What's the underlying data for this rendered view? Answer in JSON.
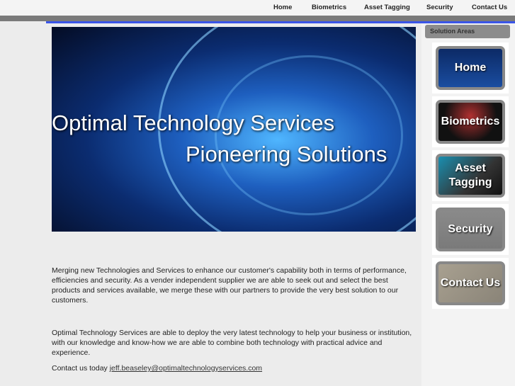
{
  "nav": [
    "Home",
    "Biometrics",
    "Asset Tagging",
    "Security",
    "Contact Us"
  ],
  "hero": {
    "title": "Optimal Technology Services",
    "subtitle": "Pioneering Solutions"
  },
  "sidebar": {
    "heading": "Solution Areas",
    "buttons": [
      "Home",
      "Biometrics",
      "Asset Tagging",
      "Security",
      "Contact Us"
    ]
  },
  "content": {
    "p1": "Merging new Technologies and Services to enhance our customer's capability both in terms of performance, efficiencies and security. As a vender independent supplier we are able to seek out and select the best products and services available, we merge these with our partners to provide the very best solution to our customers.",
    "p2": "Optimal Technology Services are able to deploy the very latest technology to help your business or institution, with our knowledge and know-how we are able to combine both technology with practical advice and experience.",
    "contact_prefix": "Contact us today",
    "email": "jeff.beaseley@optimaltechnologyservices.com"
  }
}
